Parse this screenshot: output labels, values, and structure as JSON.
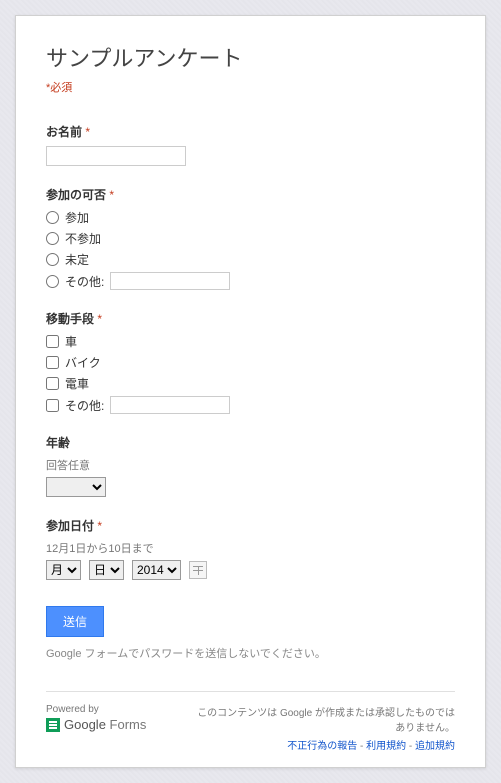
{
  "header": {
    "title": "サンプルアンケート",
    "required_note": "*必須"
  },
  "q_name": {
    "label": "お名前"
  },
  "q_attend": {
    "label": "参加の可否",
    "options": [
      "参加",
      "不参加",
      "未定"
    ],
    "other_label": "その他:"
  },
  "q_transport": {
    "label": "移動手段",
    "options": [
      "車",
      "バイク",
      "電車"
    ],
    "other_label": "その他:"
  },
  "q_age": {
    "label": "年齢",
    "desc": "回答任意"
  },
  "q_date": {
    "label": "参加日付",
    "desc": "12月1日から10日まで",
    "month_label": "月",
    "day_label": "日",
    "year_label": "2014"
  },
  "submit": {
    "label": "送信"
  },
  "pw_note": "Google フォームでパスワードを送信しないでください。",
  "footer": {
    "powered": "Powered by",
    "google": "Google",
    "forms": "Forms",
    "disclaimer": "このコンテンツは Google が作成または承認したものではありません。",
    "link_abuse": "不正行為の報告",
    "link_tos": "利用規約",
    "link_add": "追加規約",
    "sep": " - "
  }
}
